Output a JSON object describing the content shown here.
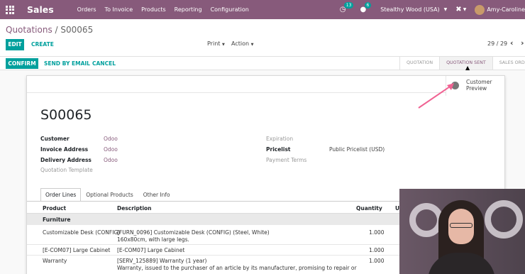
{
  "navbar": {
    "brand": "Sales",
    "menu": [
      "Orders",
      "To Invoice",
      "Products",
      "Reporting",
      "Configuration"
    ],
    "activity_count": "13",
    "messages_count": "6",
    "company": "Stealthy Wood (USA)",
    "user": "Amy-Caroline",
    "colors": {
      "bar": "#875a7b",
      "badge": "#00a09d"
    }
  },
  "control": {
    "breadcrumb_parent": "Quotations",
    "breadcrumb_separator": "/",
    "breadcrumb_current": "S00065",
    "edit_label": "EDIT",
    "create_label": "CREATE",
    "print_label": "Print",
    "action_label": "Action",
    "pager": "29 / 29"
  },
  "status": {
    "confirm_label": "CONFIRM",
    "send_email_label": "SEND BY EMAIL",
    "cancel_label": "CANCEL",
    "stages": [
      "QUOTATION",
      "QUOTATION SENT",
      "SALES ORDER"
    ],
    "active_stage": "QUOTATION SENT"
  },
  "form": {
    "order_name": "S00065",
    "preview_label": "Customer Preview",
    "customer_label": "Customer",
    "customer_value": "Odoo",
    "invoice_address_label": "Invoice Address",
    "invoice_address_value": "Odoo",
    "delivery_address_label": "Delivery Address",
    "delivery_address_value": "Odoo",
    "quotation_template_label": "Quotation Template",
    "expiration_label": "Expiration",
    "pricelist_label": "Pricelist",
    "pricelist_value": "Public Pricelist (USD)",
    "payment_terms_label": "Payment Terms"
  },
  "tabs": [
    "Order Lines",
    "Optional Products",
    "Other Info"
  ],
  "order_lines": {
    "headers": {
      "product": "Product",
      "description": "Description",
      "quantity": "Quantity",
      "unit": "U"
    },
    "section": "Furniture",
    "rows": [
      {
        "product": "Customizable Desk (CONFIG)",
        "description_1": "[FURN_0096] Customizable Desk (CONFIG) (Steel, White)",
        "description_2": "160x80cm, with large legs.",
        "quantity": "1.000"
      },
      {
        "product": "[E-COM07] Large Cabinet",
        "description_1": "[E-COM07] Large Cabinet",
        "description_2": "",
        "quantity": "1.000"
      },
      {
        "product": "Warranty",
        "description_1": "[SERV_125889] Warranty (1 year)",
        "description_2": "Warranty, issued to the purchaser of an article by its manufacturer, promising to repair or",
        "quantity": "1.000"
      }
    ]
  },
  "icons": {
    "apps": "apps-grid-icon",
    "activity": "clock-icon",
    "messages": "chat-icon",
    "debug": "bug-icon",
    "preview": "globe-icon",
    "pager_prev": "chevron-left-icon",
    "pager_next": "chevron-right-icon"
  }
}
